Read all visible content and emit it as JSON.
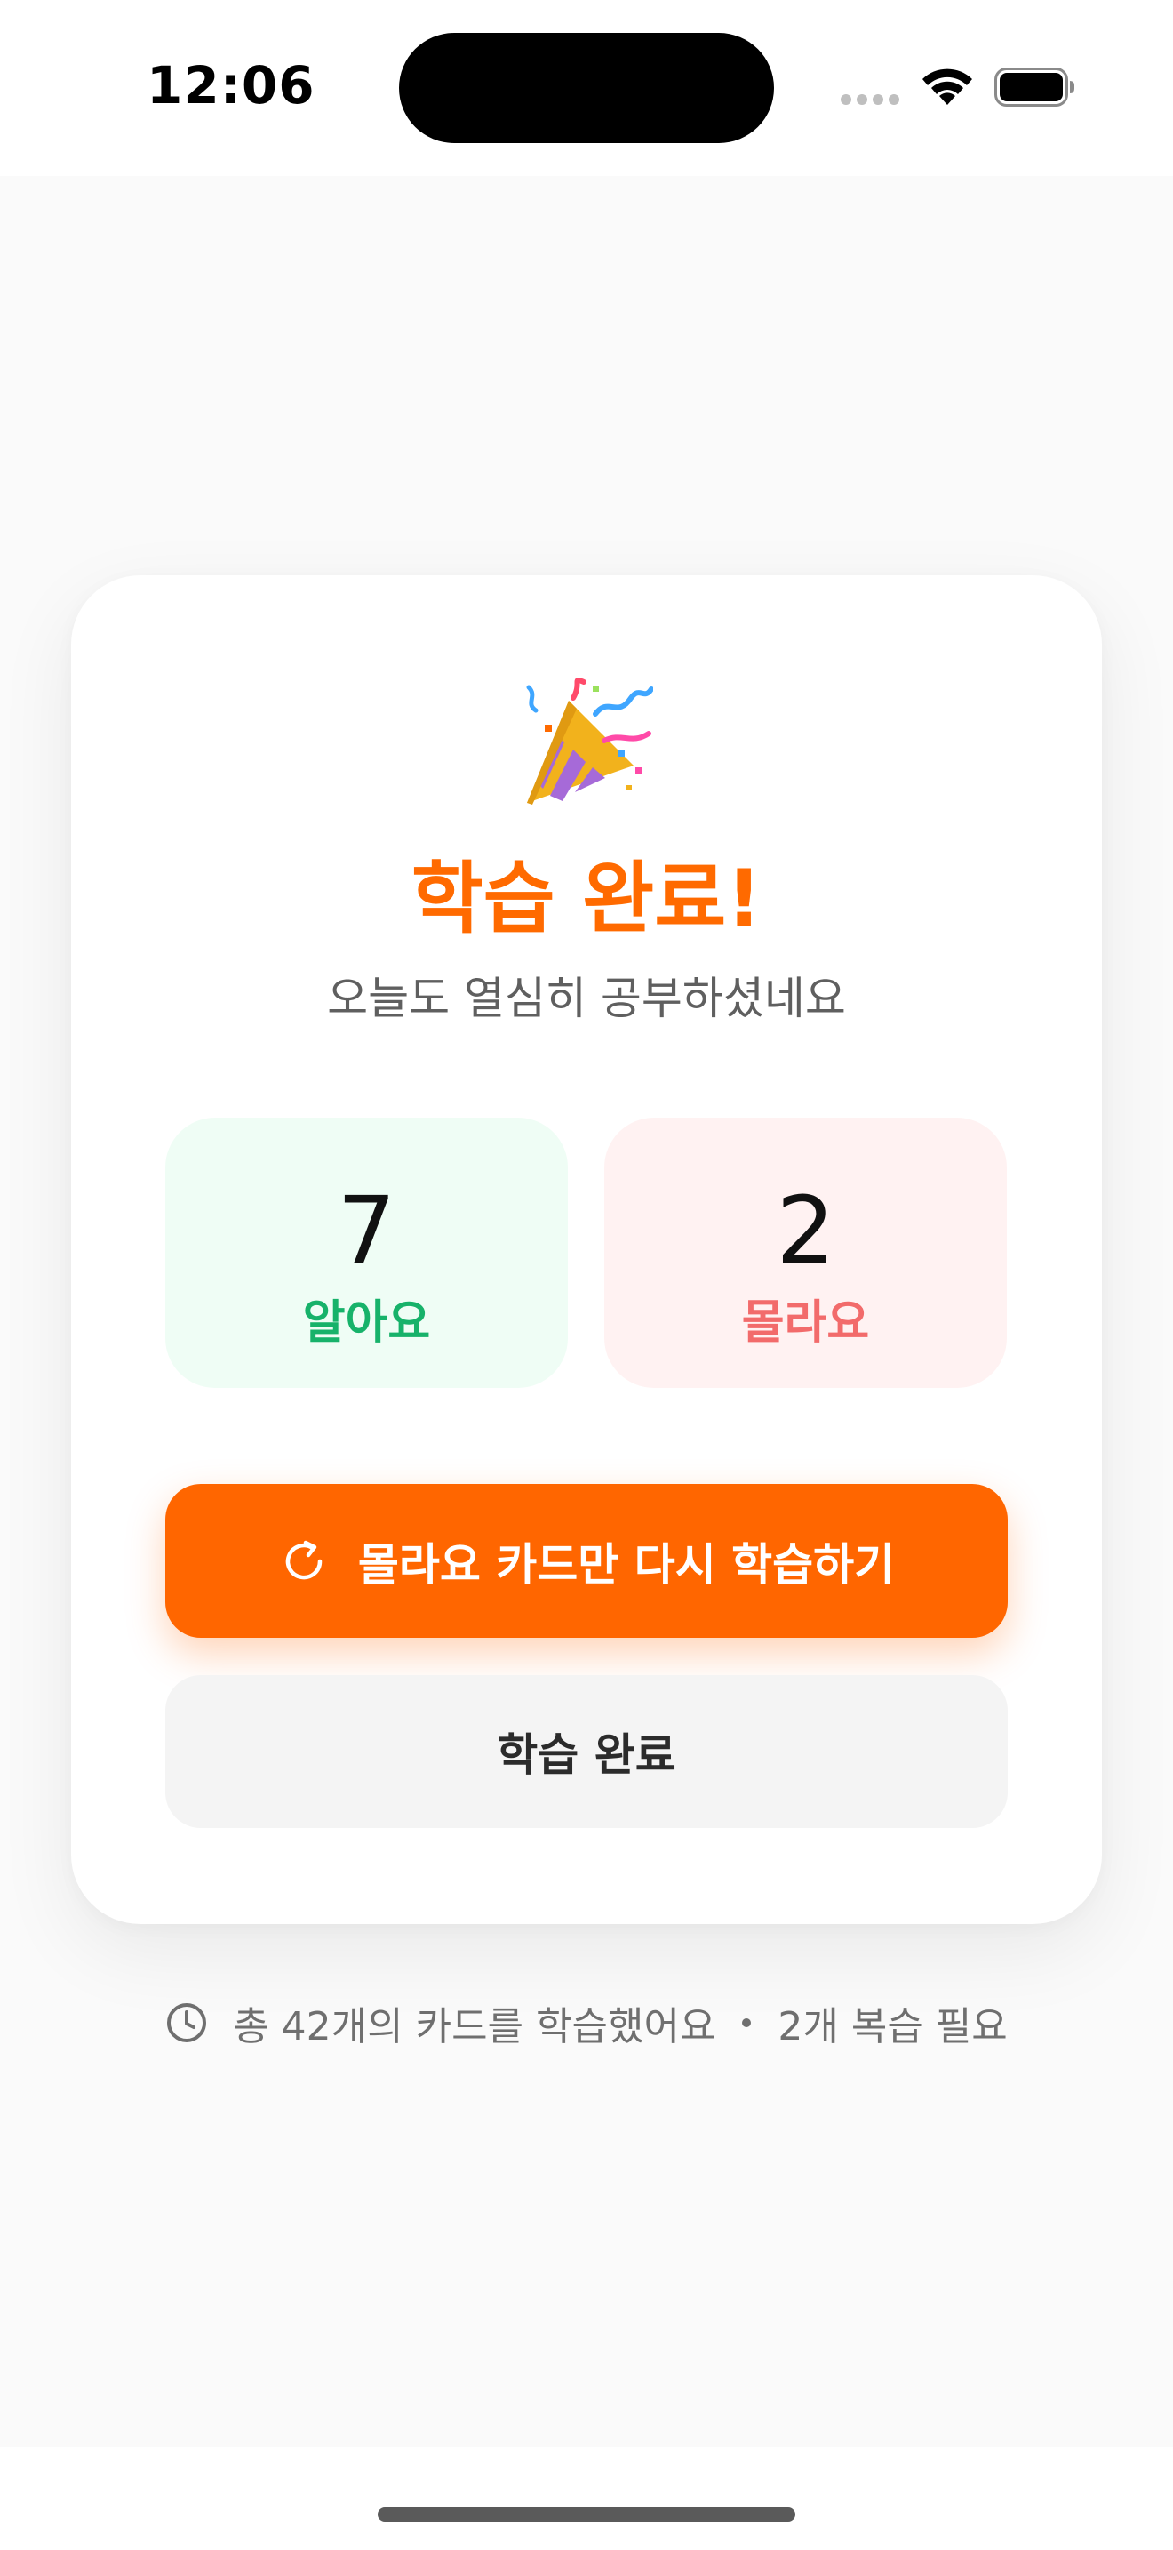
{
  "status_bar": {
    "time": "12:06"
  },
  "completion": {
    "icon": "party-popper-icon",
    "title": "학습 완료!",
    "subtitle": "오늘도 열심히 공부하셨네요"
  },
  "stats": {
    "known": {
      "value": "7",
      "label": "알아요",
      "color": "#17b26a"
    },
    "unknown": {
      "value": "2",
      "label": "몰라요",
      "color": "#f26b6b"
    }
  },
  "actions": {
    "retry_label": "몰라요 카드만 다시 학습하기",
    "retry_icon": "refresh-icon",
    "finish_label": "학습 완료"
  },
  "summary": {
    "icon": "clock-icon",
    "studied_text": "총 42개의 카드를 학습했어요",
    "review_text": "2개 복습 필요"
  },
  "colors": {
    "accent": "#ff6600",
    "background": "#fafafa"
  }
}
